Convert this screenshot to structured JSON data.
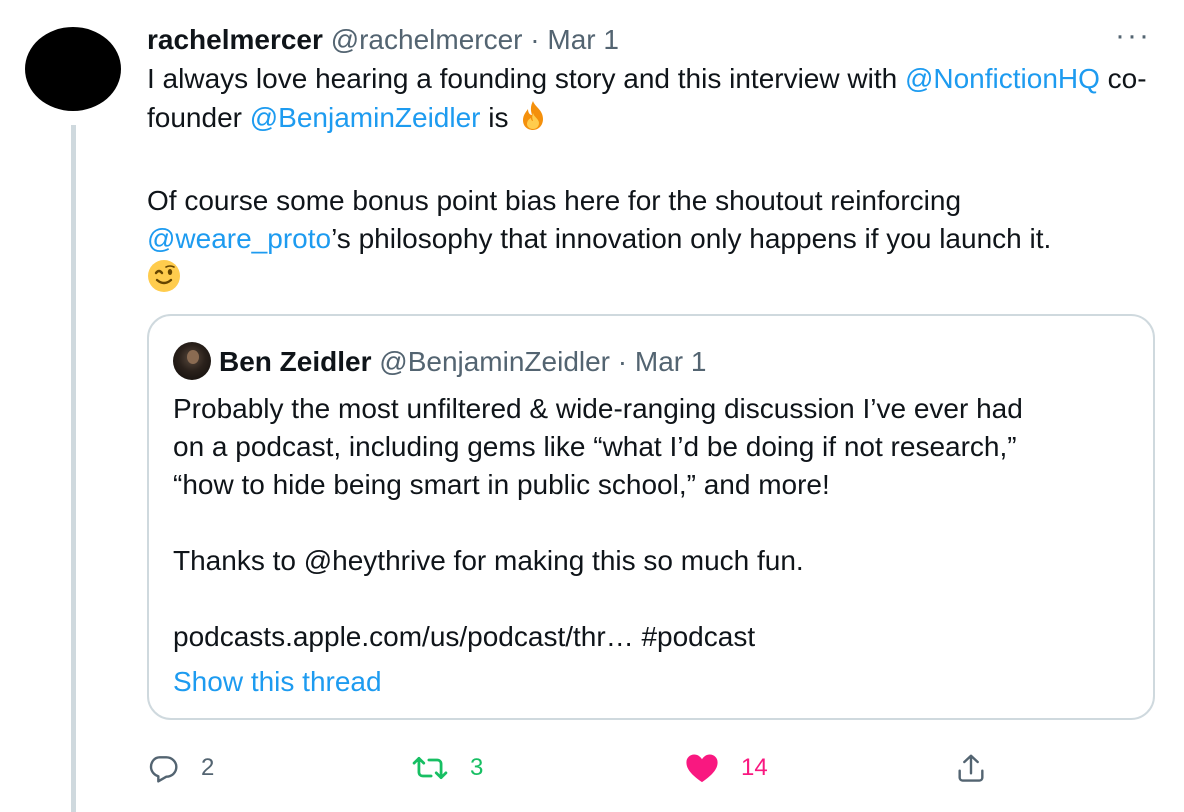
{
  "tweet": {
    "author_name": "rachelmercer",
    "author_handle": "@rachelmercer",
    "separator": "·",
    "date": "Mar 1",
    "more_label": "···",
    "paragraph1": {
      "text_a": "I always love hearing a founding story and this interview with ",
      "mention1": "@NonfictionHQ",
      "text_b": " co-founder ",
      "mention2": "@BenjaminZeidler",
      "text_c": " is ",
      "emoji": "fire-emoji"
    },
    "paragraph2": {
      "text_a": "Of course some bonus point bias here for the shoutout reinforcing ",
      "mention": "@weare_proto",
      "text_b": "’s philosophy that innovation only happens if you launch it.",
      "emoji": "winking-face-emoji"
    }
  },
  "quote": {
    "author_name": "Ben Zeidler",
    "author_handle": "@BenjaminZeidler",
    "separator": "·",
    "date": "Mar 1",
    "line1": "Probably the most unfiltered & wide-ranging discussion I’ve ever had",
    "line2": "on a podcast, including gems like “what I’d be doing if not research,”",
    "line3": "“how to hide being smart in public school,” and more!",
    "line4": "Thanks to @heythrive for making this so much fun.",
    "line5": "podcasts.apple.com/us/podcast/thr… #podcast",
    "show_thread": "Show this thread"
  },
  "actions": {
    "reply_count": "2",
    "retweet_count": "3",
    "like_count": "14",
    "reply_icon": "reply-icon",
    "retweet_icon": "retweet-icon",
    "like_icon": "heart-icon",
    "share_icon": "share-icon"
  },
  "colors": {
    "link": "#1d9bf0",
    "muted": "#536471",
    "retweet": "#17bf63",
    "like": "#f91880",
    "border": "#cfd9de"
  }
}
